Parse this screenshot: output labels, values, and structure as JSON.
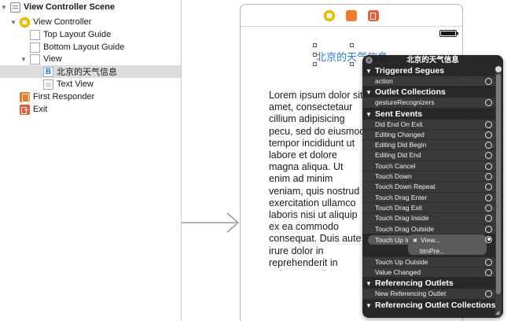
{
  "outline": {
    "items": [
      {
        "label": "View Controller Scene",
        "icon": "scene-icon"
      },
      {
        "label": "View Controller",
        "icon": "view-controller-icon"
      },
      {
        "label": "Top Layout Guide",
        "icon": "layout-guide-icon"
      },
      {
        "label": "Bottom Layout Guide",
        "icon": "layout-guide-icon"
      },
      {
        "label": "View",
        "icon": "view-icon"
      },
      {
        "label": "北京的天气信息",
        "icon": "button-icon"
      },
      {
        "label": "Text View",
        "icon": "text-view-icon"
      },
      {
        "label": "First Responder",
        "icon": "first-responder-icon"
      },
      {
        "label": "Exit",
        "icon": "exit-icon"
      }
    ],
    "button_icon_glyph": "B"
  },
  "canvas": {
    "button_title": "北京的天气信息",
    "lorem_text": "Lorem ipsum dolor sit amet, consectetaur cillium adipisicing pecu, sed do eiusmod tempor incididunt ut labore et dolore magna aliqua. Ut enim ad minim veniam, quis nostrud exercitation ullamco laboris nisi ut aliquip ex ea commodo consequat. Duis aute irure dolor in reprehenderit in voluptate velit esse cillum dolore eu fugiat nulla pariatur. Excepteur sint occaecat cupidatat non proident, sunt in culpa qui officia deserunt mollit anim id est laborum. Nam liber te conscient to factor tum poen legum odioque civiuda."
  },
  "hud": {
    "title": "北京的天气信息",
    "sections": {
      "triggered_segues": {
        "label": "Triggered Segues",
        "items": [
          "action"
        ]
      },
      "outlet_collections": {
        "label": "Outlet Collections",
        "items": [
          "gestureRecognizers"
        ]
      },
      "sent_events": {
        "label": "Sent Events",
        "items": [
          "Did End On Exit",
          "Editing Changed",
          "Editing Did Begin",
          "Editing Did End",
          "Touch Cancel",
          "Touch Down",
          "Touch Down Repeat",
          "Touch Drag Enter",
          "Touch Drag Exit",
          "Touch Drag Inside",
          "Touch Drag Outside"
        ],
        "connected": {
          "event": "Touch Up In...",
          "target_line1": "View...",
          "target_line2": "btnPre..."
        },
        "items_after": [
          "Touch Up Outside",
          "Value Changed"
        ]
      },
      "referencing_outlets": {
        "label": "Referencing Outlets",
        "items": [
          "New Referencing Outlet"
        ]
      },
      "referencing_outlet_collections": {
        "label": "Referencing Outlet Collections"
      }
    }
  },
  "colors": {
    "button_title": "#2a7ae2",
    "hud_background": "#161616",
    "selected_row": "#dcdcdc"
  }
}
